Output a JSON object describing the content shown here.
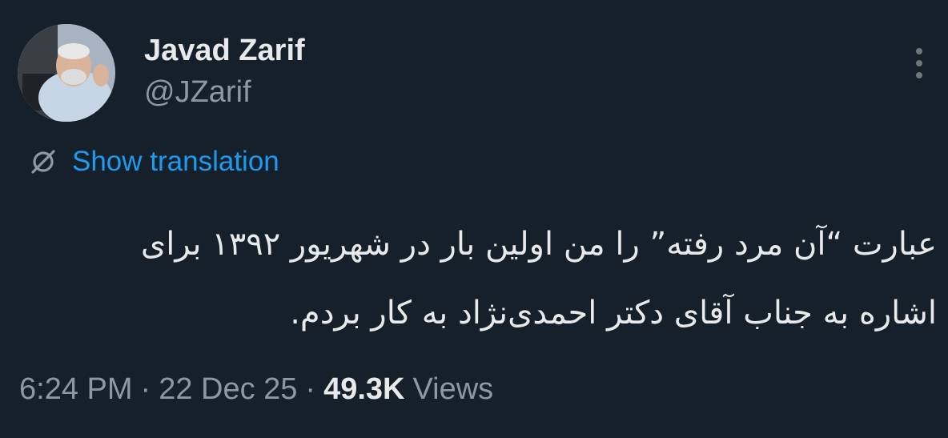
{
  "author": {
    "display_name": "Javad Zarif",
    "handle": "@JZarif",
    "avatar_icon": "profile-photo"
  },
  "translation": {
    "icon": "translate-icon",
    "label": "Show translation"
  },
  "tweet": {
    "lines": [
      "عبارت “آن مرد رفته” را من اولین بار در شهریور ۱۳۹۲ برای",
      "اشاره به جناب آقای دکتر احمدی‌نژاد به کار بردم."
    ]
  },
  "meta": {
    "time": "6:24 PM",
    "separator": "·",
    "date": "22 Dec 25",
    "views_count": "49.3K",
    "views_label": "Views"
  },
  "colors": {
    "background": "#15202b",
    "accent": "#1d9bf0",
    "secondary_text": "#8b98a5"
  }
}
